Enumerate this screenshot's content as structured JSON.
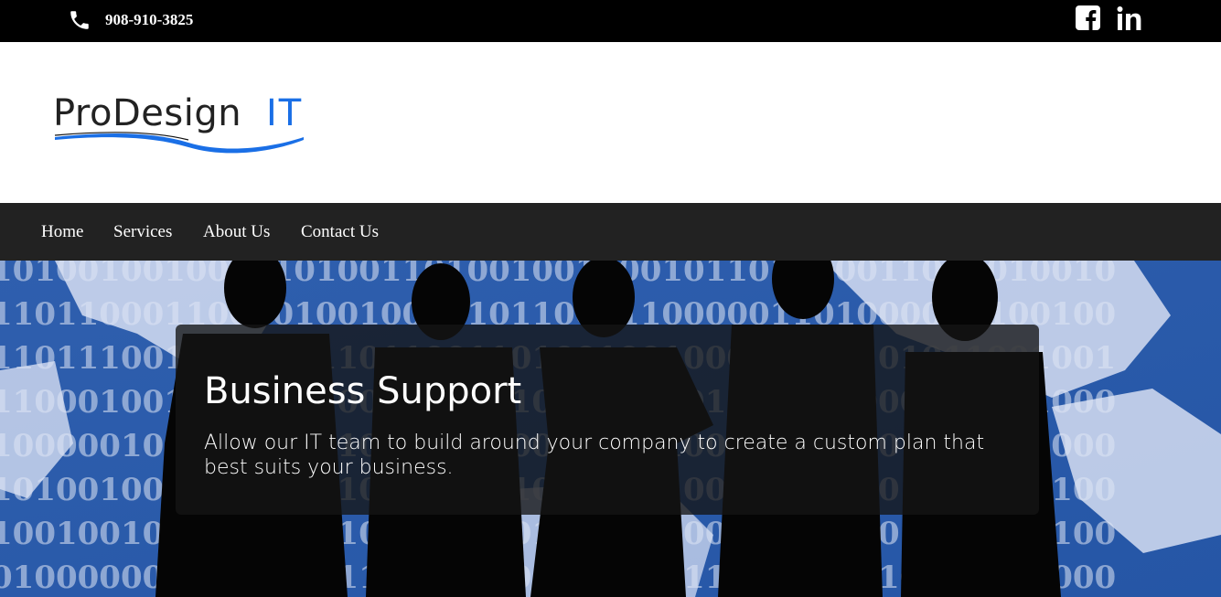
{
  "topbar": {
    "phone_icon": "phone-icon",
    "phone": "908-910-3825",
    "social": [
      "facebook-icon",
      "linkedin-icon"
    ]
  },
  "logo": {
    "text_dark": "ProDesign",
    "text_accent": "IT",
    "accent_color": "#1a6fe6"
  },
  "nav": {
    "items": [
      "Home",
      "Services",
      "About Us",
      "Contact Us"
    ]
  },
  "hero": {
    "title": "Business Support",
    "text": "Allow our IT team to build around your company to create a custom plan that best suits your business."
  },
  "colors": {
    "topbar_bg": "#000000",
    "nav_bg": "#222222",
    "hero_blue": "#3465b0"
  }
}
